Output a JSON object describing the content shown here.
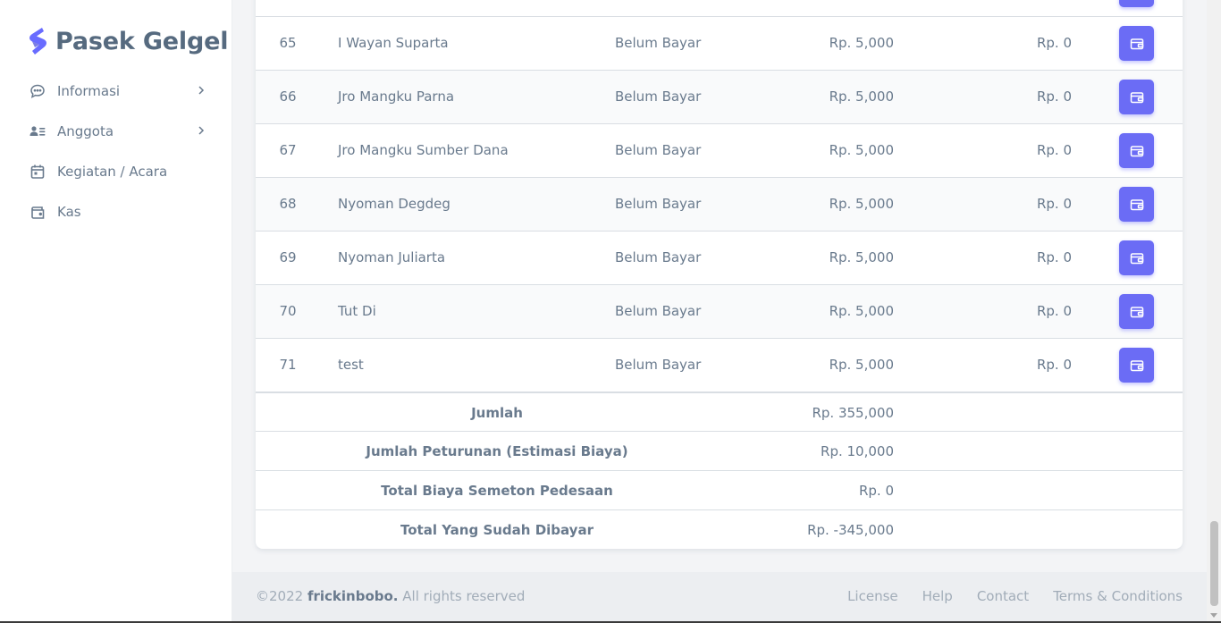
{
  "brand": {
    "name": "Pasek Gelgel",
    "logo_color": "#696cff"
  },
  "sidebar": {
    "items": [
      {
        "label": "Informasi",
        "icon": "chat-bubble-icon",
        "has_submenu": true
      },
      {
        "label": "Anggota",
        "icon": "user-list-icon",
        "has_submenu": true
      },
      {
        "label": "Kegiatan / Acara",
        "icon": "calendar-icon",
        "has_submenu": false
      },
      {
        "label": "Kas",
        "icon": "wallet-icon",
        "has_submenu": false
      }
    ]
  },
  "table": {
    "rows": [
      {
        "no": "65",
        "name": "I Wayan Suparta",
        "status": "Belum Bayar",
        "amount": "Rp. 5,000",
        "paid": "Rp. 0"
      },
      {
        "no": "66",
        "name": "Jro Mangku Parna",
        "status": "Belum Bayar",
        "amount": "Rp. 5,000",
        "paid": "Rp. 0"
      },
      {
        "no": "67",
        "name": "Jro Mangku Sumber Dana",
        "status": "Belum Bayar",
        "amount": "Rp. 5,000",
        "paid": "Rp. 0"
      },
      {
        "no": "68",
        "name": "Nyoman Degdeg",
        "status": "Belum Bayar",
        "amount": "Rp. 5,000",
        "paid": "Rp. 0"
      },
      {
        "no": "69",
        "name": "Nyoman Juliarta",
        "status": "Belum Bayar",
        "amount": "Rp. 5,000",
        "paid": "Rp. 0"
      },
      {
        "no": "70",
        "name": "Tut Di",
        "status": "Belum Bayar",
        "amount": "Rp. 5,000",
        "paid": "Rp. 0"
      },
      {
        "no": "71",
        "name": "test",
        "status": "Belum Bayar",
        "amount": "Rp. 5,000",
        "paid": "Rp. 0"
      }
    ],
    "summary": [
      {
        "label": "Jumlah",
        "value": "Rp. 355,000"
      },
      {
        "label": "Jumlah Peturunan (Estimasi Biaya)",
        "value": "Rp. 10,000"
      },
      {
        "label": "Total Biaya Semeton Pedesaan",
        "value": "Rp. 0"
      },
      {
        "label": "Total Yang Sudah Dibayar",
        "value": "Rp. -345,000"
      }
    ],
    "action_icon": "wallet-icon",
    "action_color": "#696cff"
  },
  "footer": {
    "copyright_prefix": "©2022 ",
    "author": "frickinbobo.",
    "rights": " All rights reserved",
    "links": [
      "License",
      "Help",
      "Contact",
      "Terms & Conditions"
    ]
  }
}
